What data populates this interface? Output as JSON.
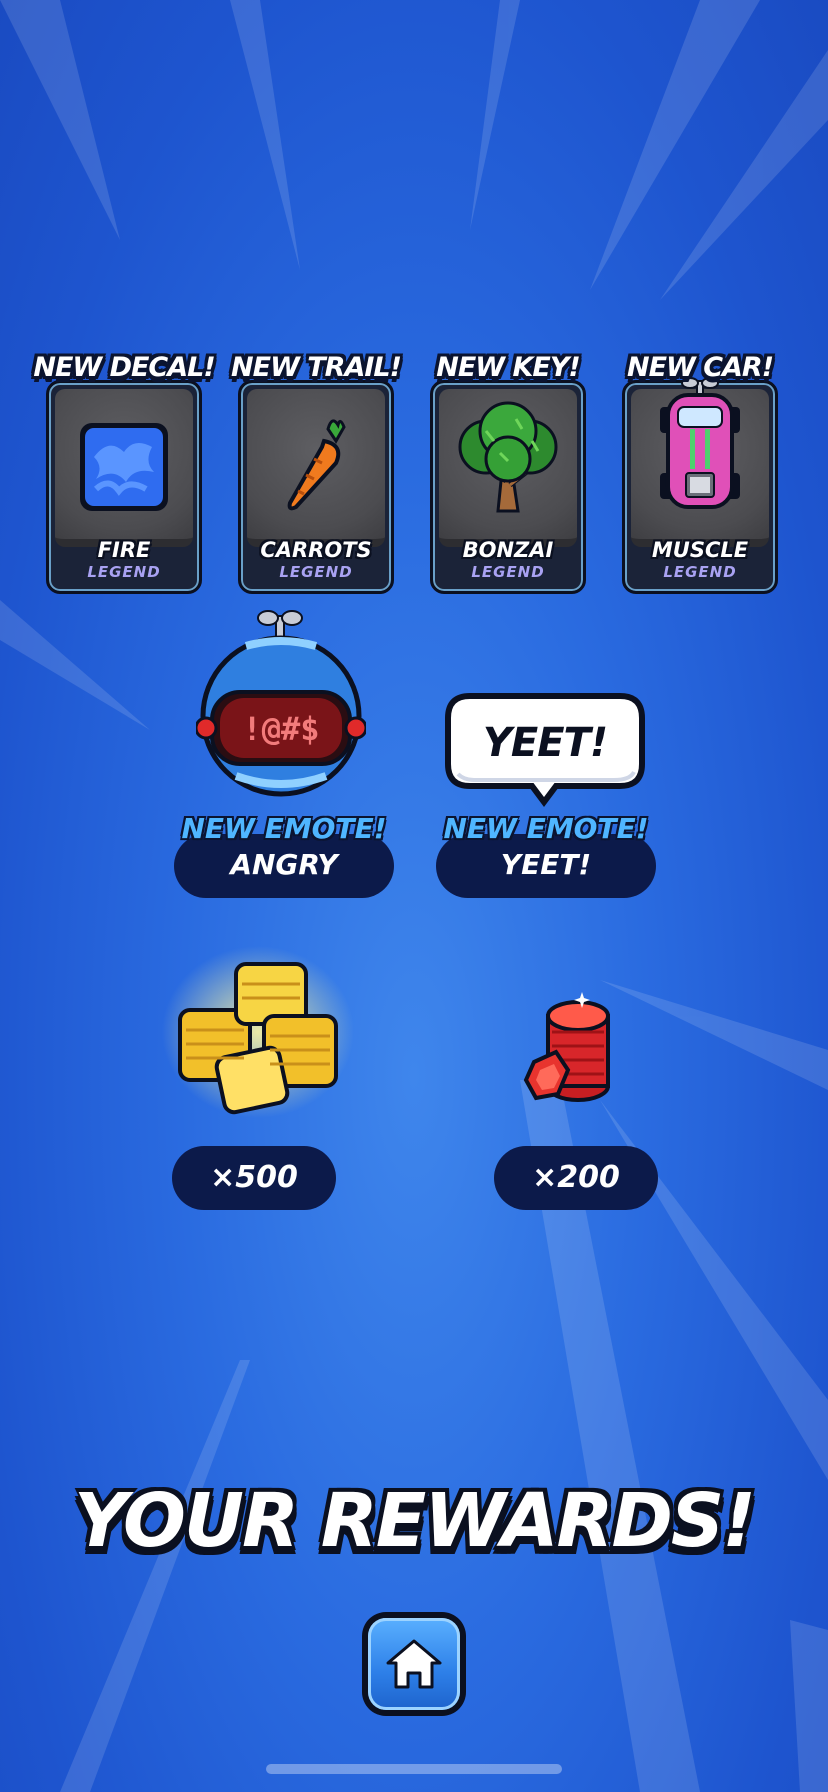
{
  "rewards": [
    {
      "header": "NEW DECAL!",
      "name": "FIRE",
      "rarity": "LEGEND",
      "icon": "fire-decal-icon"
    },
    {
      "header": "NEW TRAIL!",
      "name": "CARROTS",
      "rarity": "LEGEND",
      "icon": "carrot-icon"
    },
    {
      "header": "NEW KEY!",
      "name": "BONZAI",
      "rarity": "LEGEND",
      "icon": "bonsai-tree-icon"
    },
    {
      "header": "NEW CAR!",
      "name": "MUSCLE",
      "rarity": "LEGEND",
      "icon": "muscle-car-icon"
    }
  ],
  "emotes": [
    {
      "title": "NEW EMOTE!",
      "name": "ANGRY",
      "icon": "angry-robot-emote-icon"
    },
    {
      "title": "NEW EMOTE!",
      "name": "YEET!",
      "bubble_text": "YEET!",
      "icon": "speech-bubble-icon"
    }
  ],
  "currencies": [
    {
      "amount": "×500",
      "icon": "gold-coins-icon"
    },
    {
      "amount": "×200",
      "icon": "red-gems-icon"
    }
  ],
  "title": "YOUR REWARDS!",
  "home_button": {
    "icon": "home-icon"
  },
  "colors": {
    "background": "#2a6be0",
    "pill": "#0c1a4a",
    "emote_title": "#4fb6ff",
    "rarity": "#a9a2f2"
  }
}
